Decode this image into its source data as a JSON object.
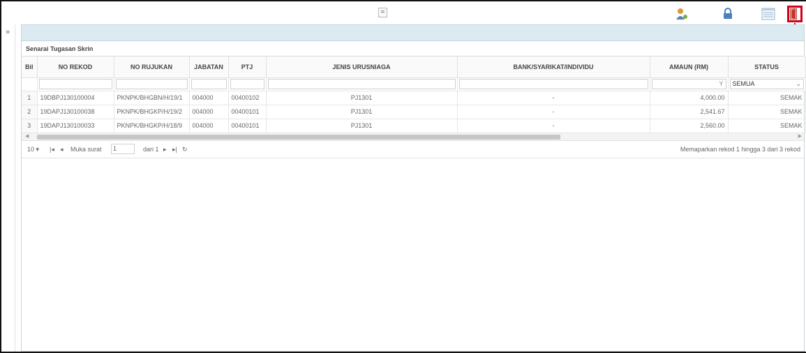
{
  "toolbar": {
    "collapse_glyph": "≈",
    "icons": [
      "user-icon",
      "lock-icon",
      "table-icon",
      "exit-icon"
    ]
  },
  "callout": {
    "number": "1",
    "color": "#d0021b"
  },
  "sidebar": {
    "expand_glyph": "»"
  },
  "grid": {
    "title": "Senarai Tugasan Skrin",
    "columns": [
      "Bil",
      "NO REKOD",
      "NO RUJUKAN",
      "JABATAN",
      "PTJ",
      "JENIS URUSNIAGA",
      "BANK/SYARIKAT/INDIVIDU",
      "AMAUN (RM)",
      "STATUS"
    ],
    "status_filter": "SEMUA",
    "rows": [
      {
        "bil": "1",
        "no_rekod": "19DBPJ130100004",
        "no_rujukan": "PKNPK/BHGBN/H/19/1",
        "jabatan": "004000",
        "ptj": "00400102",
        "jenis": "PJ1301",
        "bank": "-",
        "amaun": "4,000.00",
        "status": "SEMAK"
      },
      {
        "bil": "2",
        "no_rekod": "19DAPJ130100038",
        "no_rujukan": "PKNPK/BHGKP/H/19/2",
        "jabatan": "004000",
        "ptj": "00400101",
        "jenis": "PJ1301",
        "bank": "-",
        "amaun": "2,541.67",
        "status": "SEMAK"
      },
      {
        "bil": "3",
        "no_rekod": "19DAPJ130100033",
        "no_rujukan": "PKNPK/BHGKP/H/18/9",
        "jabatan": "004000",
        "ptj": "00400101",
        "jenis": "PJ1301",
        "bank": "-",
        "amaun": "2,560.00",
        "status": "SEMAK"
      }
    ]
  },
  "pager": {
    "page_size": "10 ▾",
    "first": "|◂",
    "prev": "◂",
    "page_label": "Muka surat",
    "page_value": "1",
    "of_label": "dari 1",
    "next": "▸",
    "last": "▸|",
    "refresh": "↻",
    "info": "Memaparkan rekod 1 hingga 3 dari 3 rekod"
  }
}
